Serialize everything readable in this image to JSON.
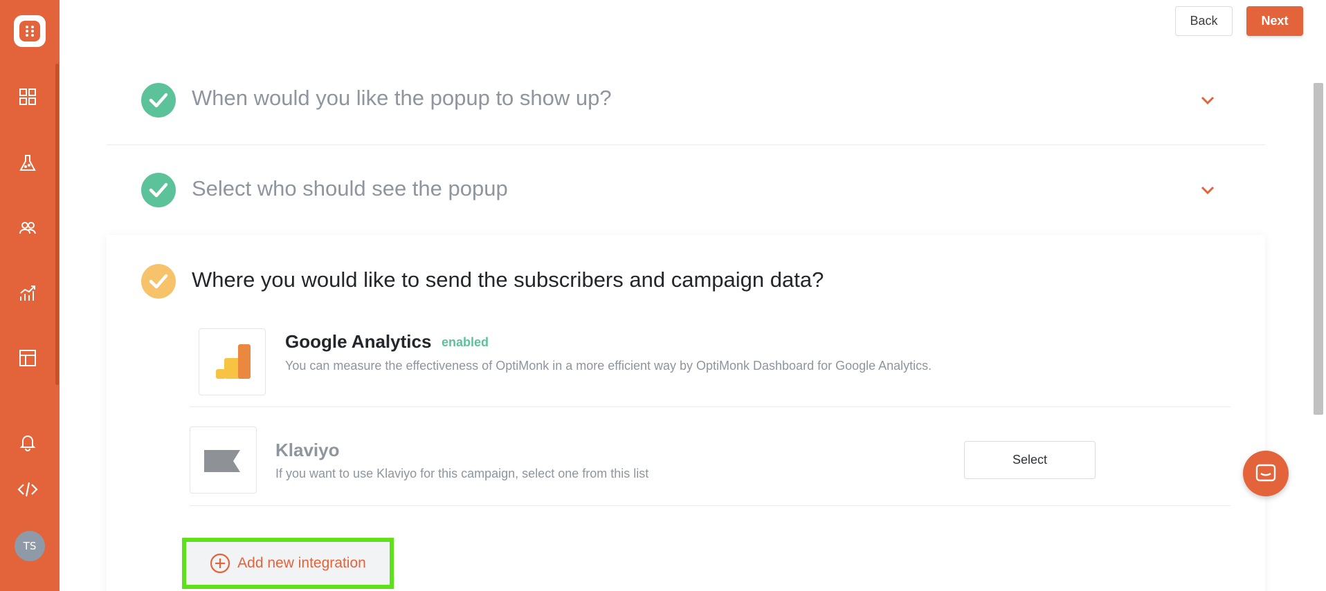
{
  "colors": {
    "brand": "#e3633a",
    "success": "#5cc29a",
    "pending": "#f6c36b",
    "highlight": "#5ee01b"
  },
  "sidebar": {
    "icons": [
      "dashboard-icon",
      "experiments-icon",
      "subscribers-icon",
      "analytics-icon",
      "templates-icon",
      "notifications-icon",
      "code-icon"
    ],
    "avatar_initials": "TS"
  },
  "header": {
    "back_label": "Back",
    "next_label": "Next"
  },
  "steps": [
    {
      "title": "When would you like the popup to show up?",
      "status": "done"
    },
    {
      "title": "Select who should see the popup",
      "status": "done"
    },
    {
      "title": "Where you would like to send the subscribers and campaign data?",
      "status": "active"
    }
  ],
  "integrations": [
    {
      "name": "Google Analytics",
      "badge": "enabled",
      "description": "You can measure the effectiveness of OptiMonk in a more efficient way by OptiMonk Dashboard for Google Analytics.",
      "icon": "google-analytics-icon"
    },
    {
      "name": "Klaviyo",
      "description": "If you want to use Klaviyo for this campaign, select one from this list",
      "action_label": "Select",
      "icon": "klaviyo-icon"
    }
  ],
  "add_integration_label": "Add new integration"
}
